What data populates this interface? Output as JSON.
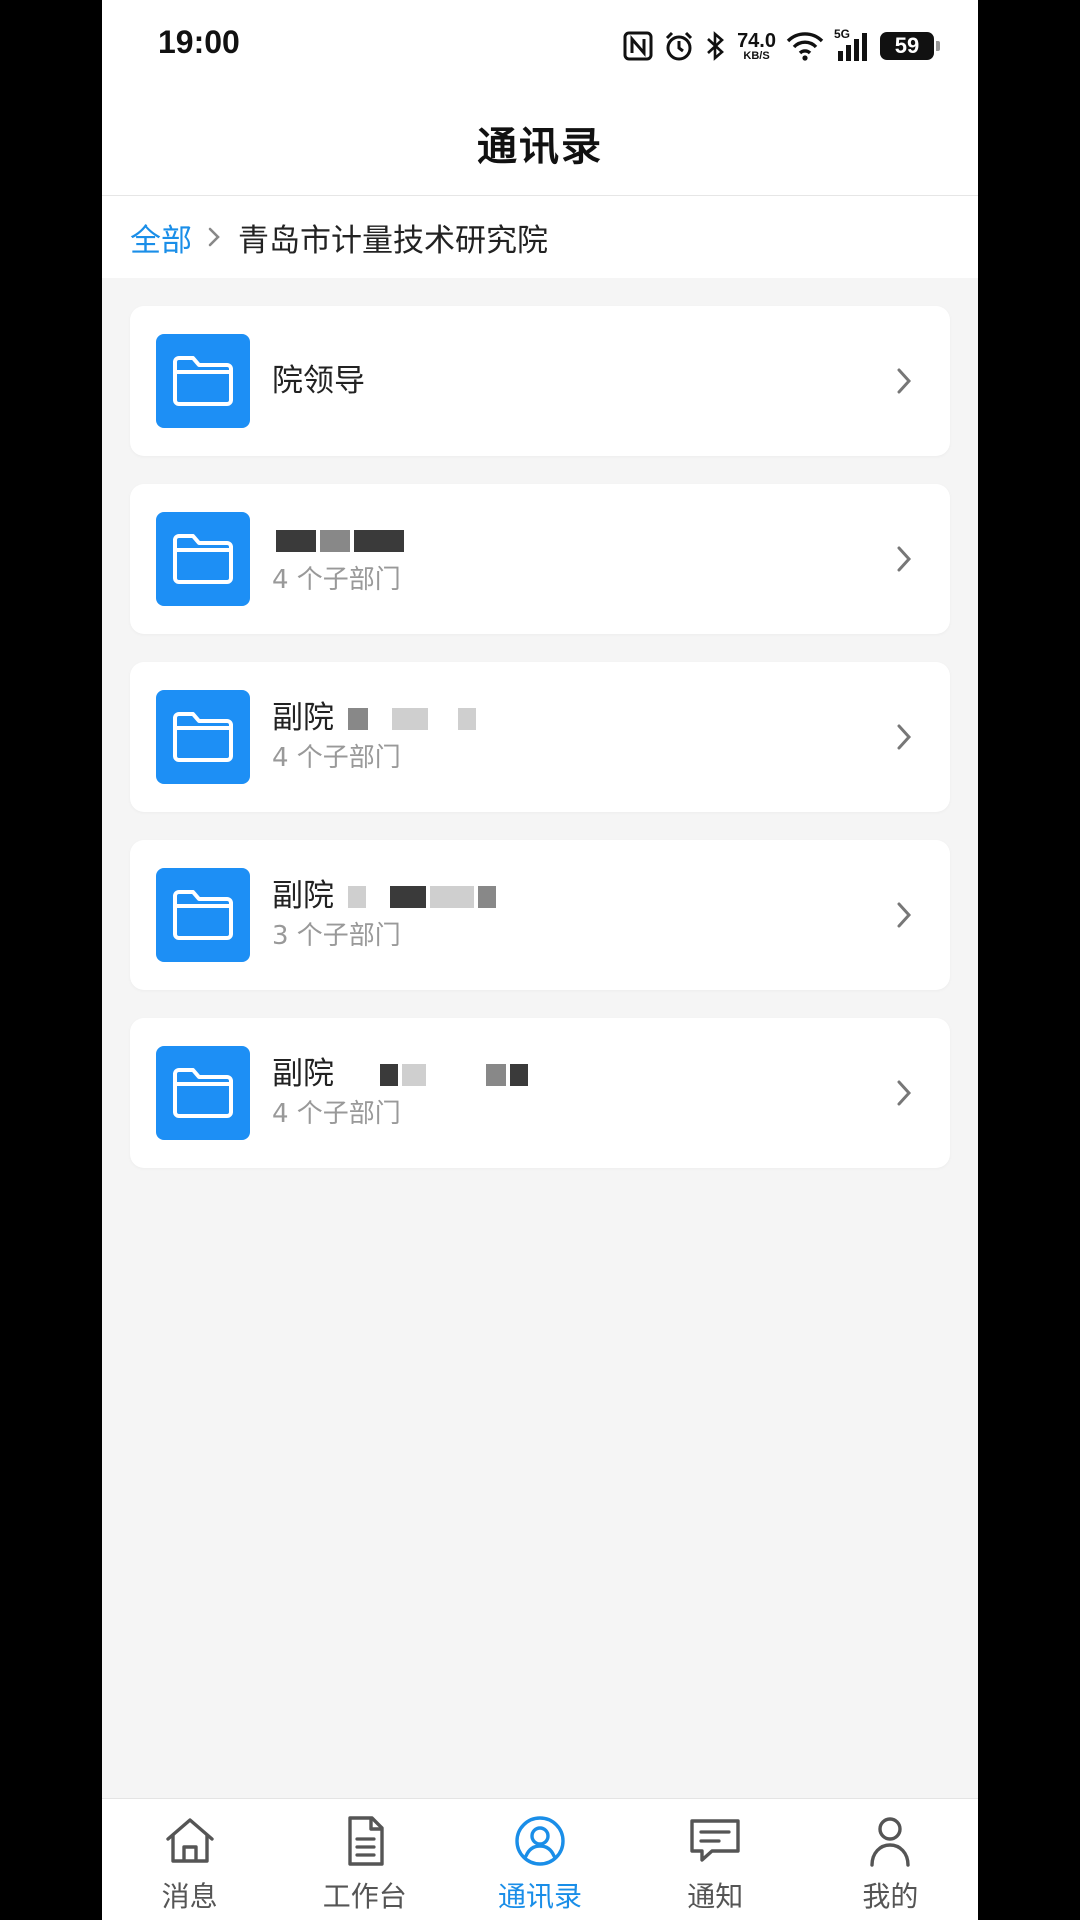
{
  "status_bar": {
    "time": "19:00",
    "net_speed_value": "74.0",
    "net_speed_unit": "KB/S",
    "signal_label": "5G",
    "battery": "59",
    "icons": [
      "nfc-icon",
      "alarm-icon",
      "bluetooth-icon",
      "wifi-icon",
      "cellular-signal-icon",
      "battery-icon"
    ]
  },
  "header": {
    "title": "通讯录"
  },
  "breadcrumb": {
    "root": "全部",
    "current": "青岛市计量技术研究院"
  },
  "departments": [
    {
      "title": "院领导",
      "subtitle": ""
    },
    {
      "title": "",
      "subtitle": "4 个子部门"
    },
    {
      "title": "副院",
      "subtitle": "4 个子部门"
    },
    {
      "title": "副院",
      "subtitle": "3 个子部门"
    },
    {
      "title": "副院",
      "subtitle": "4 个子部门"
    }
  ],
  "nav": {
    "items": [
      {
        "label": "消息",
        "icon": "home-icon"
      },
      {
        "label": "工作台",
        "icon": "document-icon"
      },
      {
        "label": "通讯录",
        "icon": "contacts-icon"
      },
      {
        "label": "通知",
        "icon": "message-icon"
      },
      {
        "label": "我的",
        "icon": "user-icon"
      }
    ],
    "active_index": 2
  },
  "colors": {
    "accent": "#1a8ee8",
    "folder": "#1d8ff5",
    "background": "#f5f5f5"
  }
}
